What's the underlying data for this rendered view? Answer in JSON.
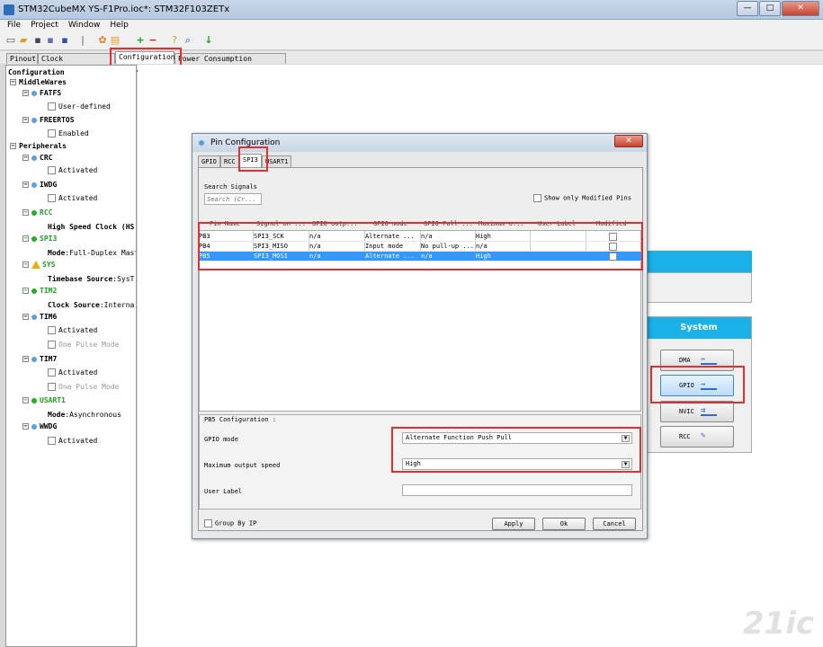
{
  "window": {
    "title": "STM32CubeMX YS-F1Pro.ioc*: STM32F103ZETx",
    "min": "—",
    "max": "□",
    "close": "✕"
  },
  "menu": {
    "items": [
      "File",
      "Project",
      "Window",
      "Help"
    ]
  },
  "toolbar": {
    "icons": [
      "new-icon",
      "open-icon",
      "save-icon",
      "save-as-icon",
      "generate-icon",
      "report-icon",
      "plus-icon",
      "minus-icon",
      "help-icon",
      "search-icon",
      "download-icon"
    ]
  },
  "tabs": {
    "pinout": "Pinout",
    "clock": "Clock Configuration",
    "configuration": "Configuration",
    "power": "Power Consumption Calculator"
  },
  "tree": {
    "root": "Configuration",
    "middlewares": "MiddleWares",
    "fatfs": "FATFS",
    "fatfs_opt": "User-defined",
    "freertos": "FREERTOS",
    "freertos_opt": "Enabled",
    "peripherals": "Peripherals",
    "crc": "CRC",
    "crc_opt": "Activated",
    "iwdg": "IWDG",
    "iwdg_opt": "Activated",
    "rcc": "RCC",
    "rcc_opt": "High Speed Clock (HS",
    "spi3": "SPI3",
    "spi3_mode_label": "Mode",
    "spi3_mode_value": ":Full-Duplex Maste",
    "sys": "SYS",
    "sys_tb_label": "Timebase Source",
    "sys_tb_value": ":SysT",
    "tim2": "TIM2",
    "tim2_cs_label": "Clock Source",
    "tim2_cs_value": ":Interna",
    "tim6": "TIM6",
    "tim6_opt1": "Activated",
    "tim6_opt2": "One Pulse Mode",
    "tim7": "TIM7",
    "tim7_opt1": "Activated",
    "tim7_opt2": "One Pulse Mode",
    "usart1": "USART1",
    "usart1_mode_label": "Mode",
    "usart1_mode_value": ":Asynchronous",
    "wwdg": "WWDG",
    "wwdg_opt": "Activated"
  },
  "system_panel": {
    "title": "System",
    "buttons": {
      "dma": "DMA",
      "gpio": "GPIO",
      "nvic": "NVIC",
      "rcc": "RCC"
    }
  },
  "dialog": {
    "title": "Pin Configuration",
    "close": "✕",
    "tabs": {
      "gpio": "GPIO",
      "rcc": "RCC",
      "spi3": "SPI3",
      "usart1": "USART1"
    },
    "search_label": "Search Signals",
    "search_placeholder": "Search (Cr...",
    "show_modified": "Show only Modified Pins",
    "columns": [
      "Pin Name",
      "Signal on ...",
      "GPIO outp...",
      "GPIO mode",
      "GPIO Pull-...",
      "Maximum o...",
      "User Label",
      "Modified"
    ],
    "rows": [
      {
        "pin": "PB3",
        "signal": "SPI3_SCK",
        "output": "n/a",
        "mode": "Alternate ...",
        "pull": "n/a",
        "max": "High",
        "label": ""
      },
      {
        "pin": "PB4",
        "signal": "SPI3_MISO",
        "output": "n/a",
        "mode": "Input mode",
        "pull": "No pull-up ...",
        "max": "n/a",
        "label": ""
      },
      {
        "pin": "PB5",
        "signal": "SPI3_MOSI",
        "output": "n/a",
        "mode": "Alternate ...",
        "pull": "n/a",
        "max": "High",
        "label": ""
      }
    ],
    "config_title": "PB5 Configuration :",
    "gpio_mode_label": "GPIO mode",
    "gpio_mode_value": "Alternate Function Push Pull",
    "max_speed_label": "Maximum output speed",
    "max_speed_value": "High",
    "user_label": "User Label",
    "group_by_ip": "Group By IP",
    "apply": "Apply",
    "ok": "Ok",
    "cancel": "Cancel"
  },
  "watermark": "21ic"
}
